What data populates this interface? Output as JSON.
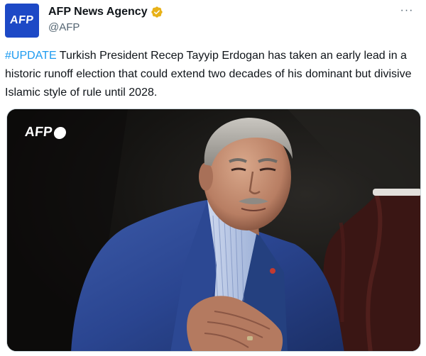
{
  "tweet": {
    "avatar_text": "AFP",
    "display_name": "AFP News Agency",
    "handle": "@AFP",
    "more_label": "···",
    "text": {
      "hashtag": "#UPDATE",
      "body": " Turkish President Recep Tayyip Erdogan has taken an early lead in a historic runoff election that could extend two decades of his dominant but divisive Islamic style of rule until 2028."
    },
    "media": {
      "watermark": "AFP"
    }
  },
  "icons": {
    "verified": "verified-badge-icon",
    "more": "more-options-icon"
  },
  "colors": {
    "verified": "#e8b219",
    "hashtag": "#1d9bf0",
    "avatar_bg": "#1d49c6",
    "handle": "#536471"
  }
}
